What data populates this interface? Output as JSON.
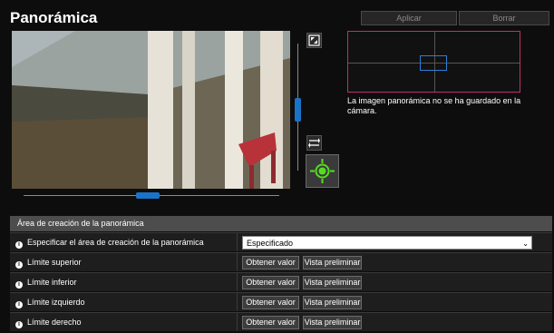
{
  "header": {
    "title": "Panorámica",
    "apply_label": "Aplicar",
    "clear_label": "Borrar"
  },
  "preview": {
    "note": "La imagen panorámica no se ha guardado en la cámara."
  },
  "section": {
    "title": "Área de creación de la panorámica"
  },
  "rows": [
    {
      "label": "Especificar el área de creación de la panorámica",
      "select_value": "Especificado"
    },
    {
      "label": "Límite superior",
      "get_label": "Obtener valor",
      "preview_label": "Vista preliminar"
    },
    {
      "label": "Límite inferior",
      "get_label": "Obtener valor",
      "preview_label": "Vista preliminar"
    },
    {
      "label": "Límite izquierdo",
      "get_label": "Obtener valor",
      "preview_label": "Vista preliminar"
    },
    {
      "label": "Límite derecho",
      "get_label": "Obtener valor",
      "preview_label": "Vista preliminar"
    }
  ],
  "colors": {
    "accent": "#1a73c8",
    "frame": "#c0306a",
    "ptz_target": "#55dd22"
  }
}
